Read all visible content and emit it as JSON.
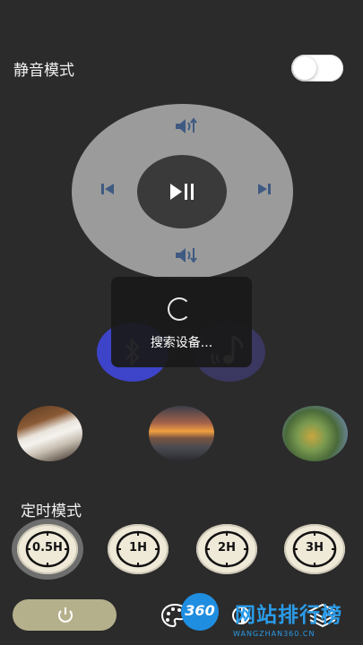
{
  "mute": {
    "label": "静音模式",
    "enabled": false
  },
  "remote": {
    "icons": [
      "volume-up-icon",
      "previous-icon",
      "play-pause-icon",
      "next-icon",
      "volume-down-icon"
    ],
    "pad_color": "#9b9b9b",
    "center_color": "#3a3a3a",
    "icon_color": "#3f5a82"
  },
  "toast": {
    "text": "搜索设备..."
  },
  "devices": {
    "bluetooth": {
      "icon": "bluetooth-icon",
      "color": "#3d44c9"
    },
    "music": {
      "icon": "music-icon",
      "color": "#3a3760"
    }
  },
  "scenes": [
    {
      "name": "piano"
    },
    {
      "name": "sunset-sea"
    },
    {
      "name": "garden-birds"
    }
  ],
  "timer": {
    "label": "定时模式",
    "options": [
      "0.5H",
      "1H",
      "2H",
      "3H"
    ],
    "selected": "0.5H"
  },
  "bottom_bar": {
    "power_color": "#b5b08c",
    "icons": [
      "power-icon",
      "palette-icon",
      "brightness-icon",
      "layers-icon"
    ]
  },
  "watermark": {
    "logo": "360",
    "title": "网站排行榜",
    "subtitle": "WANGZHAN360.CN"
  }
}
